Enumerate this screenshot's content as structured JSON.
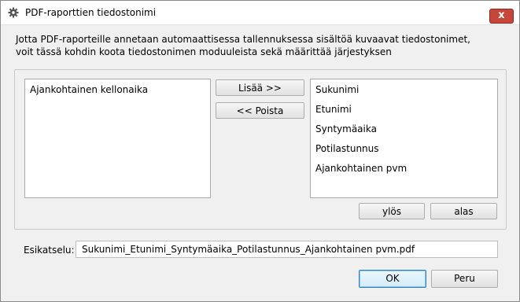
{
  "window": {
    "title": "PDF-raporttien tiedostonimi",
    "close_label": "x"
  },
  "description": {
    "line1": "Jotta PDF-raporteille annetaan automaattisessa tallennuksessa sisältöä kuvaavat tiedostonimet,",
    "line2": "voit tässä kohdin koota tiedostonimen moduuleista sekä määrittää järjestyksen"
  },
  "available_list": {
    "items": [
      "Ajankohtainen kellonaika"
    ]
  },
  "buttons": {
    "add": "Lisää >>",
    "remove": "<< Poista",
    "up": "ylös",
    "down": "alas",
    "ok": "OK",
    "cancel": "Peru"
  },
  "selected_list": {
    "items": [
      "Sukunimi",
      "Etunimi",
      "Syntymäaika",
      "Potilastunnus",
      "Ajankohtainen pvm"
    ]
  },
  "preview": {
    "label": "Esikatselu:",
    "value": "Sukunimi_Etunimi_Syntymäaika_Potilastunnus_Ajankohtainen pvm.pdf"
  }
}
